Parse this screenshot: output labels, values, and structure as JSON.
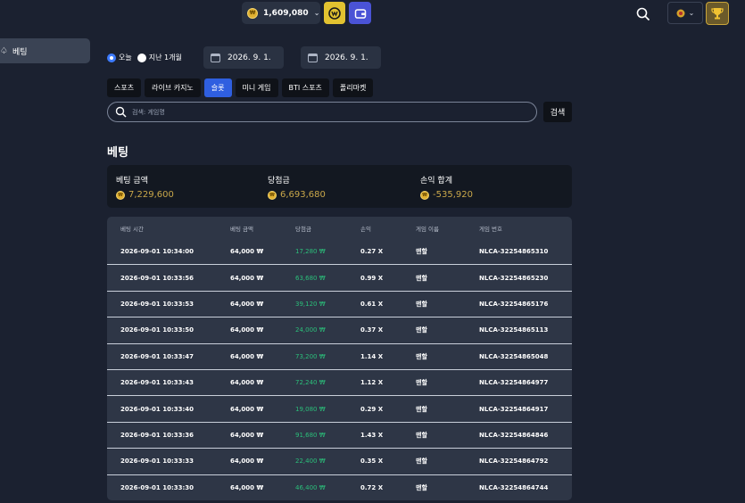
{
  "header": {
    "balance": "1,609,080",
    "coin_symbol": "₩",
    "lang_flag": "flag-icon",
    "icons": [
      "wallet-icon",
      "search-icon",
      "trophy-icon"
    ]
  },
  "sidebar": {
    "items": [
      {
        "label": "베팅",
        "icon": "bet-icon"
      }
    ]
  },
  "filters": {
    "today_label": "오늘",
    "month_label": "지난 1개월",
    "date_from": "2026. 9. 1.",
    "date_to": "2026. 9. 1."
  },
  "tabs": [
    {
      "label": "스포츠"
    },
    {
      "label": "라이브 카지노"
    },
    {
      "label": "슬롯"
    },
    {
      "label": "미니 게임"
    },
    {
      "label": "BTI 스포츠"
    },
    {
      "label": "폴리마켓"
    }
  ],
  "search": {
    "placeholder": "검색: 게임명",
    "button": "검색"
  },
  "section": {
    "title": "베팅"
  },
  "summary": {
    "bet_amount_label": "베팅 금액",
    "bet_amount": "7,229,600",
    "winnings_label": "당첨금",
    "winnings": "6,693,680",
    "pl_label": "손익 합계",
    "pl": "-535,920"
  },
  "table": {
    "headers": [
      "베팅 시간",
      "베팅 금액",
      "당첨금",
      "손익",
      "게임 이름",
      "게임 번호"
    ],
    "rows": [
      {
        "time": "2026-09-01 10:34:00",
        "amount": "64,000 ₩",
        "win": "17,280 ₩",
        "pl": "0.27 X",
        "game": "맨할",
        "id": "NLCA-32254865310"
      },
      {
        "time": "2026-09-01 10:33:56",
        "amount": "64,000 ₩",
        "win": "63,680 ₩",
        "pl": "0.99 X",
        "game": "맨할",
        "id": "NLCA-32254865230"
      },
      {
        "time": "2026-09-01 10:33:53",
        "amount": "64,000 ₩",
        "win": "39,120 ₩",
        "pl": "0.61 X",
        "game": "맨할",
        "id": "NLCA-32254865176"
      },
      {
        "time": "2026-09-01 10:33:50",
        "amount": "64,000 ₩",
        "win": "24,000 ₩",
        "pl": "0.37 X",
        "game": "맨할",
        "id": "NLCA-32254865113"
      },
      {
        "time": "2026-09-01 10:33:47",
        "amount": "64,000 ₩",
        "win": "73,200 ₩",
        "pl": "1.14 X",
        "game": "맨할",
        "id": "NLCA-32254865048"
      },
      {
        "time": "2026-09-01 10:33:43",
        "amount": "64,000 ₩",
        "win": "72,240 ₩",
        "pl": "1.12 X",
        "game": "맨할",
        "id": "NLCA-32254864977"
      },
      {
        "time": "2026-09-01 10:33:40",
        "amount": "64,000 ₩",
        "win": "19,080 ₩",
        "pl": "0.29 X",
        "game": "맨할",
        "id": "NLCA-32254864917"
      },
      {
        "time": "2026-09-01 10:33:36",
        "amount": "64,000 ₩",
        "win": "91,680 ₩",
        "pl": "1.43 X",
        "game": "맨할",
        "id": "NLCA-32254864846"
      },
      {
        "time": "2026-09-01 10:33:33",
        "amount": "64,000 ₩",
        "win": "22,400 ₩",
        "pl": "0.35 X",
        "game": "맨할",
        "id": "NLCA-32254864792"
      },
      {
        "time": "2026-09-01 10:33:30",
        "amount": "64,000 ₩",
        "win": "46,400 ₩",
        "pl": "0.72 X",
        "game": "맨할",
        "id": "NLCA-32254864744"
      }
    ]
  },
  "colors": {
    "accent": "#2f5fe0",
    "win": "#2bbf7a",
    "gold": "#c9a74a"
  }
}
